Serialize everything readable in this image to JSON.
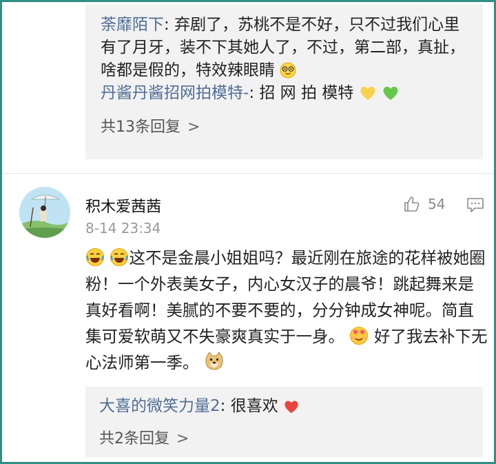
{
  "top_replies": [
    {
      "user": "荼靡陌下",
      "sep": ": ",
      "text": "弃剧了，苏桃不是不好，只不过我们心里有了月牙，装不下其她人了，不过，第二部，真扯，啥都是假的，特效辣眼睛",
      "emoji": "squinting-glasses-emoji"
    },
    {
      "user": "丹酱丹酱招网拍模特-",
      "sep": ": ",
      "text": "招 网 拍 模特",
      "emoji": [
        "yellow-heart-emoji",
        "green-heart-emoji"
      ]
    }
  ],
  "top_more": {
    "label": "共13条回复",
    "chevron": ">"
  },
  "post": {
    "user": "积木爱茜茜",
    "time": "8-14 23:34",
    "likes": "54",
    "text_main": "这不是金晨小姐姐吗？最近刚在旅途的花样被她圈粉！一个外表美女子，内心女汉子的晨爷！跳起舞来是真好看啊！美腻的不要不要的，分分钟成女神呢。简直集可爱软萌又不失豪爽真实于一身。",
    "text_tail": "好了我去补下无心法师第一季。",
    "icons": [
      "laugh-cry-emoji",
      "laugh-cry-emoji",
      "heart-eyes-emoji",
      "doge-emoji"
    ]
  },
  "bottom_reply": {
    "user": "大喜的微笑力量2",
    "sep": ": ",
    "text": "很喜欢",
    "emoji": "red-heart-emoji"
  },
  "bottom_more": {
    "label": "共2条回复",
    "chevron": ">"
  }
}
